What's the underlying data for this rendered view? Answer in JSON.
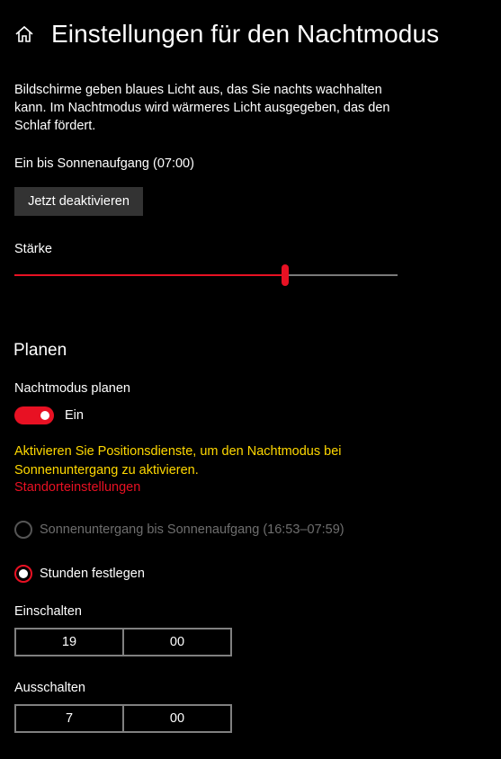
{
  "header": {
    "title": "Einstellungen für den Nachtmodus",
    "home_icon": "home-icon"
  },
  "description": "Bildschirme geben blaues Licht aus, das Sie nachts wachhalten kann. Im Nachtmodus wird wärmeres Licht ausgegeben, das den Schlaf fördert.",
  "status": "Ein bis Sonnenaufgang (07:00)",
  "deactivate_button": "Jetzt deaktivieren",
  "strength": {
    "label": "Stärke",
    "value_fraction": 0.706
  },
  "schedule": {
    "section_title": "Planen",
    "toggle_label": "Nachtmodus planen",
    "toggle_state": "Ein",
    "warning": "Aktivieren Sie Positionsdienste, um den Nachtmodus bei Sonnenuntergang zu aktivieren.",
    "location_link": "Standorteinstellungen",
    "option_sunset": "Sonnenuntergang bis Sonnenaufgang (16:53–07:59)",
    "option_hours": "Stunden festlegen",
    "on_label": "Einschalten",
    "on_hour": "19",
    "on_minute": "00",
    "off_label": "Ausschalten",
    "off_hour": "7",
    "off_minute": "00"
  },
  "colors": {
    "accent": "#e81123",
    "warning": "#ffd800",
    "background": "#000000",
    "button": "#333333"
  }
}
